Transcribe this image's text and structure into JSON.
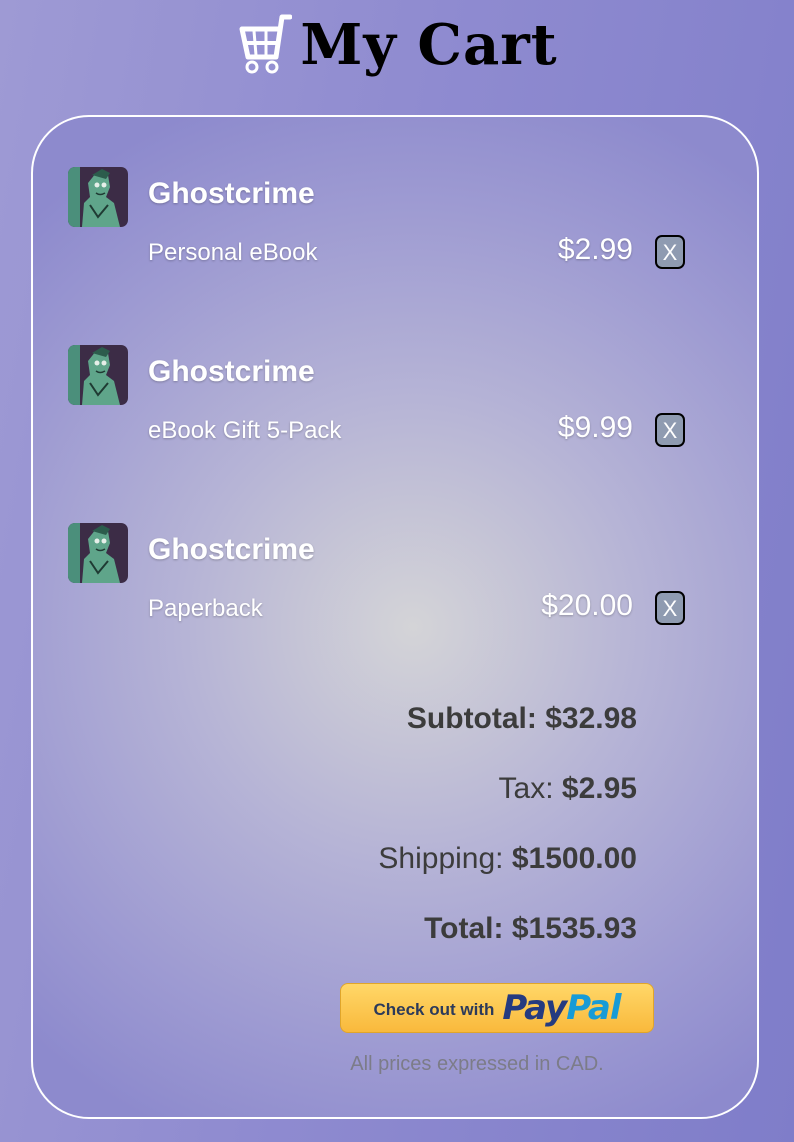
{
  "header": {
    "title": "My Cart",
    "icon": "cart-icon"
  },
  "items": [
    {
      "title": "Ghostcrime",
      "format": "Personal eBook",
      "price": "$2.99",
      "remove_label": "X",
      "thumb_icon": "book-cover-thumbnail"
    },
    {
      "title": "Ghostcrime",
      "format": "eBook Gift 5-Pack",
      "price": "$9.99",
      "remove_label": "X",
      "thumb_icon": "book-cover-thumbnail"
    },
    {
      "title": "Ghostcrime",
      "format": "Paperback",
      "price": "$20.00",
      "remove_label": "X",
      "thumb_icon": "book-cover-thumbnail"
    }
  ],
  "totals": {
    "subtotal_label": "Subtotal:",
    "subtotal_value": "$32.98",
    "tax_label": "Tax:",
    "tax_value": "$2.95",
    "shipping_label": "Shipping:",
    "shipping_value": "$1500.00",
    "total_label": "Total:",
    "total_value": "$1535.93"
  },
  "checkout": {
    "prefix": "Check out with",
    "brand_pay": "Pay",
    "brand_pal": "Pal",
    "note": "All prices expressed in CAD."
  },
  "colors": {
    "background": "#8f8bd0",
    "paypal_yellow": "#f9b93c",
    "paypal_dark_blue": "#253b80",
    "paypal_light_blue": "#179bd7",
    "text_dark": "#3c3c3c"
  }
}
